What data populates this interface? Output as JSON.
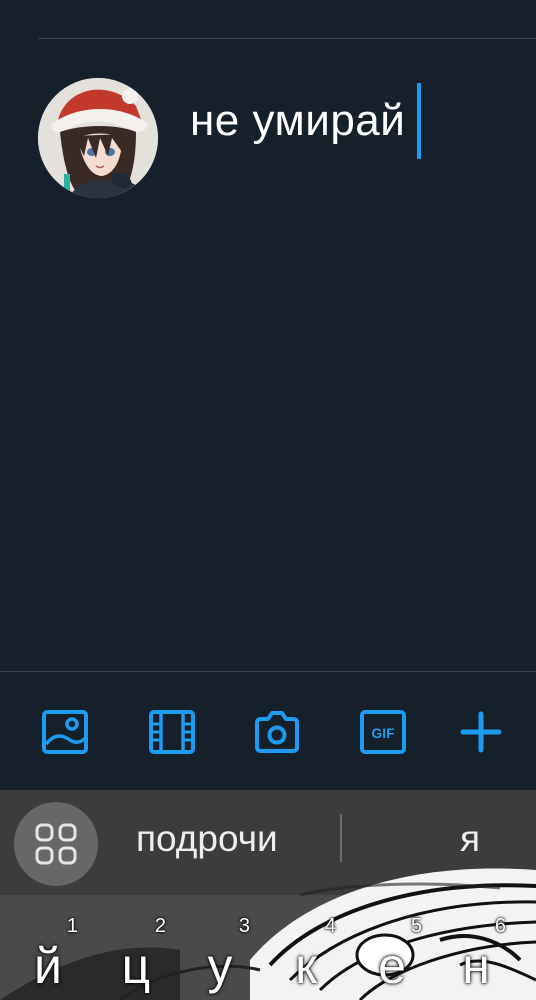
{
  "compose": {
    "text": "не умирай",
    "accent_color": "#1d9bf0",
    "background_color": "#15202b"
  },
  "toolbar": {
    "items": [
      {
        "icon": "image-icon"
      },
      {
        "icon": "video-icon"
      },
      {
        "icon": "camera-icon"
      },
      {
        "icon": "gif-icon",
        "label": "GIF"
      },
      {
        "icon": "plus-icon"
      }
    ]
  },
  "keyboard": {
    "suggestions": [
      "подрочи",
      "я"
    ],
    "apps_icon": "apps-grid-icon",
    "keys": [
      {
        "char": "й",
        "hint": "1"
      },
      {
        "char": "ц",
        "hint": "2"
      },
      {
        "char": "у",
        "hint": "3"
      },
      {
        "char": "к",
        "hint": "4"
      },
      {
        "char": "е",
        "hint": "5"
      },
      {
        "char": "н",
        "hint": "6"
      }
    ]
  }
}
